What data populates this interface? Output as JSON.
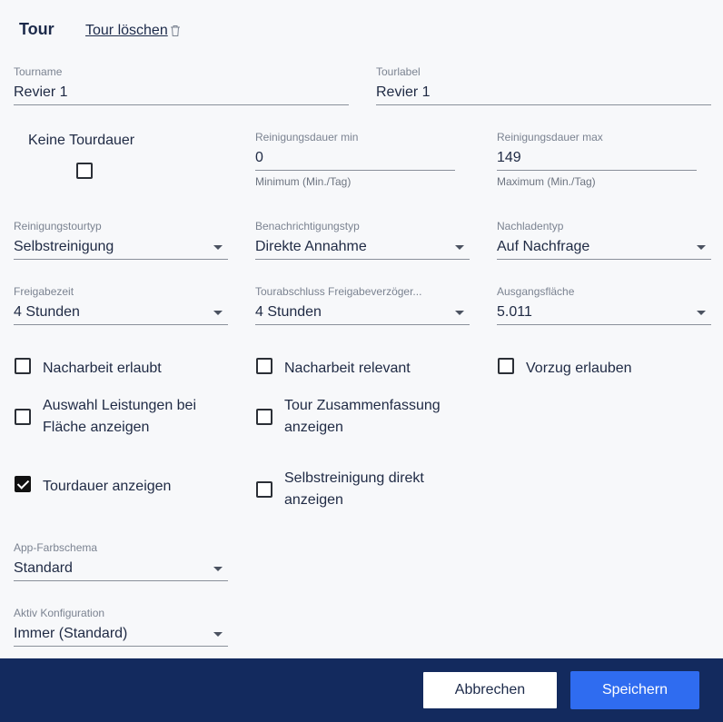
{
  "header": {
    "title": "Tour",
    "delete_label": "Tour löschen"
  },
  "fields": {
    "tourname": {
      "label": "Tourname",
      "value": "Revier 1"
    },
    "tourlabel": {
      "label": "Tourlabel",
      "value": "Revier 1"
    },
    "no_duration": {
      "label": "Keine Tourdauer",
      "checked": false
    },
    "clean_min": {
      "label": "Reinigungsdauer min",
      "value": "0",
      "hint": "Minimum (Min./Tag)"
    },
    "clean_max": {
      "label": "Reinigungsdauer max",
      "value": "149",
      "hint": "Maximum (Min./Tag)"
    },
    "tour_type": {
      "label": "Reinigungstourtyp",
      "value": "Selbstreinigung"
    },
    "notify_type": {
      "label": "Benachrichtigungstyp",
      "value": "Direkte Annahme"
    },
    "reload_type": {
      "label": "Nachladentyp",
      "value": "Auf Nachfrage"
    },
    "release_time": {
      "label": "Freigabezeit",
      "value": "4 Stunden"
    },
    "tour_close_delay": {
      "label": "Tourabschluss Freigabeverzöger...",
      "value": "4 Stunden"
    },
    "start_area": {
      "label": "Ausgangsfläche",
      "value": "5.011"
    },
    "app_color": {
      "label": "App-Farbschema",
      "value": "Standard"
    },
    "active_config": {
      "label": "Aktiv Konfiguration",
      "value": "Immer (Standard)"
    }
  },
  "checkboxes": {
    "rework_allowed": {
      "label": "Nacharbeit erlaubt",
      "checked": false
    },
    "rework_relevant": {
      "label": "Nacharbeit relevant",
      "checked": false
    },
    "priority_allowed": {
      "label": "Vorzug erlauben",
      "checked": false
    },
    "show_services_line1": "Auswahl Leistungen bei",
    "show_services_line2": "Fläche anzeigen",
    "show_summary_line1": "Tour Zusammenfassung",
    "show_summary_line2": "anzeigen",
    "show_duration": {
      "label": "Tourdauer anzeigen",
      "checked": true
    },
    "self_clean_line1": "Selbstreinigung direkt",
    "self_clean_line2": "anzeigen"
  },
  "footer": {
    "cancel_label": "Abbrechen",
    "save_label": "Speichern"
  },
  "colors": {
    "footer": "#132a5e",
    "primary": "#2f6cf0"
  }
}
